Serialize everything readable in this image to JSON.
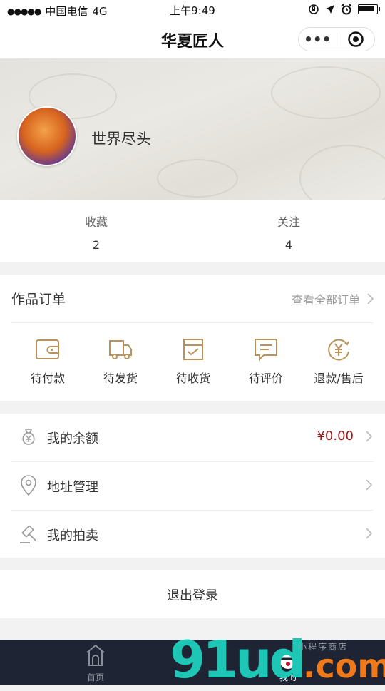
{
  "status_bar": {
    "signal": "●●●●●",
    "carrier": "中国电信",
    "network": "4G",
    "time": "上午9:49"
  },
  "nav": {
    "title": "华夏匠人",
    "more_label": "•••"
  },
  "profile": {
    "username": "世界尽头"
  },
  "stats": [
    {
      "label": "收藏",
      "value": "2"
    },
    {
      "label": "关注",
      "value": "4"
    }
  ],
  "orders": {
    "title": "作品订单",
    "view_all": "查看全部订单",
    "items": [
      {
        "label": "待付款",
        "icon": "wallet-icon"
      },
      {
        "label": "待发货",
        "icon": "delivery-truck-icon"
      },
      {
        "label": "待收货",
        "icon": "receive-box-icon"
      },
      {
        "label": "待评价",
        "icon": "comment-icon"
      },
      {
        "label": "退款/售后",
        "icon": "refund-yen-icon"
      }
    ]
  },
  "menu": [
    {
      "label": "我的余额",
      "value": "¥0.00",
      "icon": "money-bag-icon"
    },
    {
      "label": "地址管理",
      "value": "",
      "icon": "location-pin-icon"
    },
    {
      "label": "我的拍卖",
      "value": "",
      "icon": "auction-hammer-icon"
    }
  ],
  "logout_label": "退出登录",
  "tabs": [
    {
      "label": "首页",
      "icon": "home-icon",
      "active": false
    },
    {
      "label": "我的",
      "icon": "profile-icon",
      "active": true
    }
  ],
  "watermark": {
    "main": "91ud",
    "com": ".com",
    "small": "小程序商店"
  },
  "colors": {
    "accent_brown": "#b8925a",
    "price_red": "#9b1b1b",
    "tabbar_bg": "#1e2433"
  }
}
